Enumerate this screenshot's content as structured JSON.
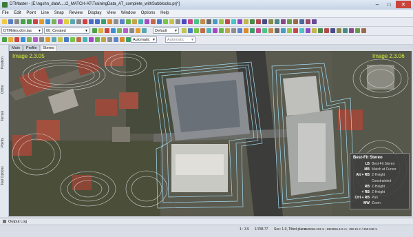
{
  "window": {
    "title": "DTMaster - [E:\\ngshn_data\\....\\2_MATCH-AT\\TrainingData_AT_complete_withSubblocks.prj*]",
    "minimize": "–",
    "maximize": "□",
    "close": "✕"
  },
  "menu": [
    "File",
    "Edit",
    "Point",
    "Line",
    "Snap",
    "Review",
    "Display",
    "View",
    "Window",
    "Options",
    "Help"
  ],
  "toolbar2": {
    "file_combo": "DTMtiles.dtm.las",
    "layer_combo": "00_Created",
    "style_combo": "Default"
  },
  "toolbar3": {
    "mode_combo": "Automatic",
    "value_combo": "Automatic"
  },
  "view_tabs": [
    "Main",
    "Profile",
    "Stereo"
  ],
  "left_tabs": [
    "Position",
    "Ortho",
    "Terrain",
    "Points",
    "Tool Options"
  ],
  "viewport": {
    "left_image_label": "Image 2.3.05",
    "right_image_label": "Image 2.3.06"
  },
  "legend": {
    "title": "Best-Fit Stereo",
    "rows": [
      {
        "key": "LB",
        "value": "Best-Fit Stereo"
      },
      {
        "key": "MB",
        "value": "Match at Cursor"
      },
      {
        "key": "Alt + RB",
        "value": "Z-Height"
      },
      {
        "key": "",
        "value": "Constrainted"
      },
      {
        "key": "RB",
        "value": "Z-Height"
      },
      {
        "key": "+ RB",
        "value": "Z-Height"
      },
      {
        "key": "Ctrl + RB",
        "value": "Pan"
      },
      {
        "key": "MW",
        "value": "Zoom"
      }
    ]
  },
  "bottom_panel": {
    "label": "Output Log"
  },
  "status": {
    "scale": "1 : 3.5",
    "ratio": "1/788.77",
    "sec": "Sec: 1.0, Tilted plane",
    "coords": "3539062.223 m ; 5328955.441 m ; 350.19 m / 350.048 m"
  },
  "colors": {
    "accent": "#d6f23a",
    "legend_bg": "#3e3e3e",
    "close": "#c9463d"
  }
}
